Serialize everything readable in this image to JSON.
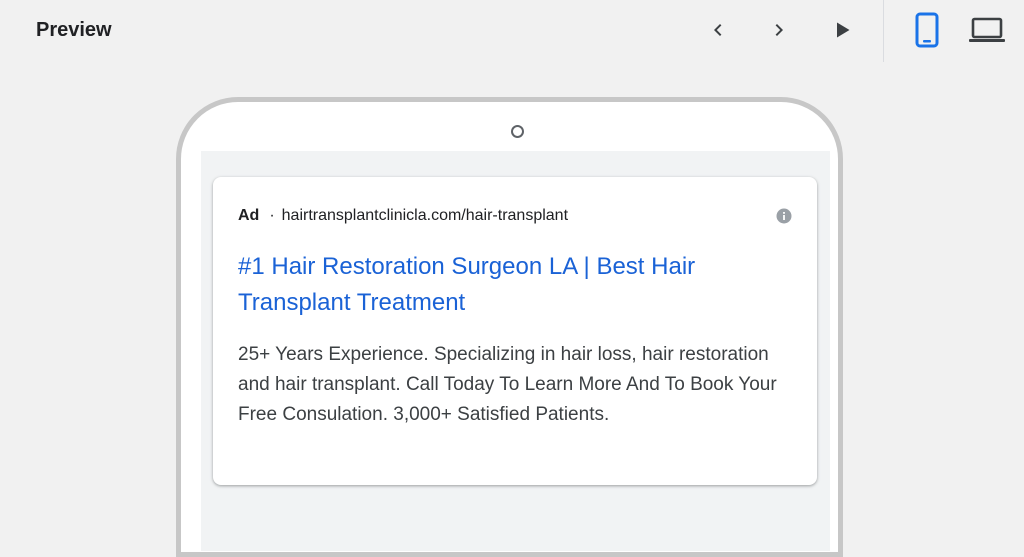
{
  "header": {
    "title": "Preview"
  },
  "toolbar": {
    "prev_icon": "chevron-left-icon",
    "next_icon": "chevron-right-icon",
    "play_icon": "play-icon",
    "mobile_icon": "smartphone-icon",
    "desktop_icon": "laptop-icon",
    "active_device": "mobile",
    "active_color": "#1a73e8"
  },
  "ad": {
    "label": "Ad",
    "separator": "·",
    "display_url": "hairtransplantclinicla.com/hair-transplant",
    "headline": "#1 Hair Restoration Surgeon LA | Best Hair Transplant Treatment",
    "description": "25+ Years Experience. Specializing in hair loss, hair restoration and hair transplant. Call Today To Learn More And To Book Your Free Consulation. 3,000+ Satisfied Patients.",
    "headline_color": "#1a62d6",
    "info_icon": "info-icon"
  }
}
